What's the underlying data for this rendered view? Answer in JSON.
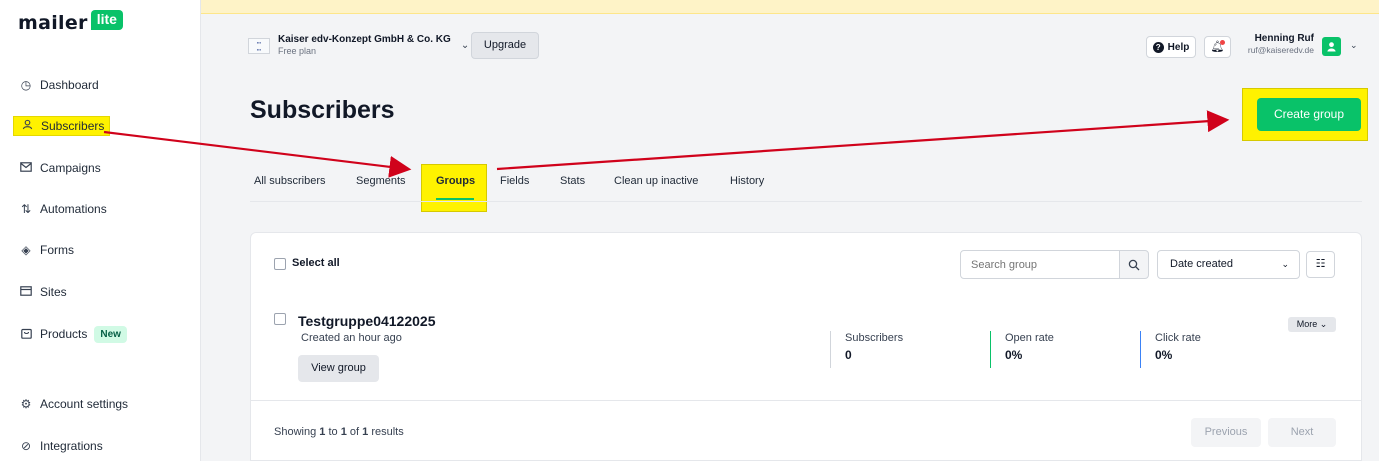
{
  "brand": {
    "logo_text": "mailer",
    "logo_badge": "lite"
  },
  "sidebar": {
    "items": [
      {
        "label": "Dashboard",
        "icon": "clock-icon"
      },
      {
        "label": "Subscribers",
        "icon": "user-icon"
      },
      {
        "label": "Campaigns",
        "icon": "mail-icon"
      },
      {
        "label": "Automations",
        "icon": "flow-icon"
      },
      {
        "label": "Forms",
        "icon": "layers-icon"
      },
      {
        "label": "Sites",
        "icon": "browser-icon"
      },
      {
        "label": "Products",
        "icon": "bag-icon",
        "badge": "New"
      },
      {
        "label": "Account settings",
        "icon": "gear-icon"
      },
      {
        "label": "Integrations",
        "icon": "link-icon"
      }
    ]
  },
  "header": {
    "org_name": "Kaiser edv-Konzept GmbH & Co. KG",
    "org_plan": "Free plan",
    "upgrade_label": "Upgrade",
    "help_label": "Help",
    "user_name": "Henning Ruf",
    "user_email": "ruf@kaiseredv.de"
  },
  "page": {
    "title": "Subscribers",
    "create_label": "Create group"
  },
  "tabs": [
    "All subscribers",
    "Segments",
    "Groups",
    "Fields",
    "Stats",
    "Clean up inactive",
    "History"
  ],
  "toolbar": {
    "select_all": "Select all",
    "search_placeholder": "Search group",
    "sort_value": "Date created"
  },
  "group": {
    "name": "Testgruppe04122025",
    "created": "Created an hour ago",
    "view_label": "View group",
    "more_label": "More",
    "stats": [
      {
        "label": "Subscribers",
        "value": "0"
      },
      {
        "label": "Open rate",
        "value": "0%"
      },
      {
        "label": "Click rate",
        "value": "0%"
      }
    ]
  },
  "pagination": {
    "showing_prefix": "Showing",
    "from": "1",
    "to_word": "to",
    "to": "1",
    "of_word": "of",
    "total": "1",
    "results_word": "results",
    "previous": "Previous",
    "next": "Next"
  },
  "colors": {
    "accent": "#09c269",
    "highlight": "#fff200",
    "arrow": "#d0021b",
    "stat_border_green": "#09c269",
    "stat_border_blue": "#3b82f6"
  }
}
